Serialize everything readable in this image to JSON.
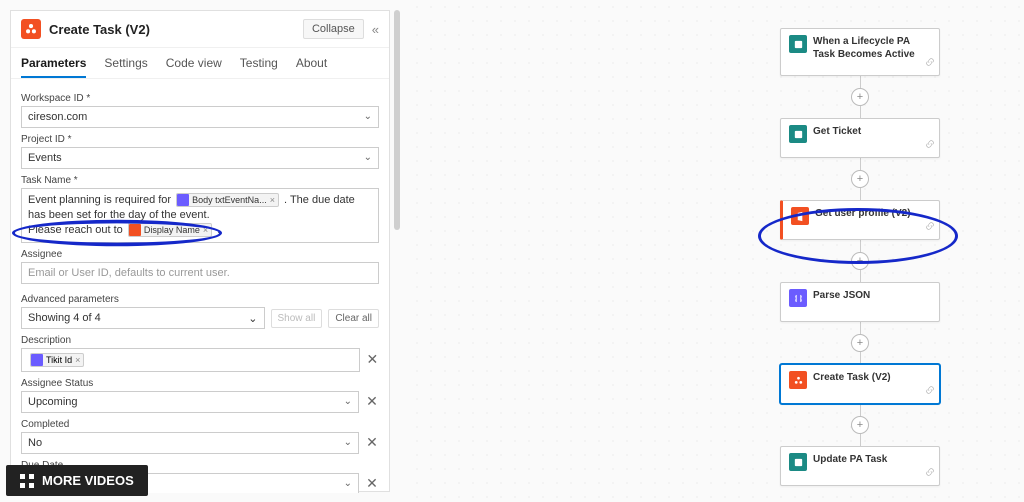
{
  "header": {
    "title": "Create Task (V2)",
    "collapse_label": "Collapse"
  },
  "tabs": [
    {
      "label": "Parameters",
      "active": true
    },
    {
      "label": "Settings",
      "active": false
    },
    {
      "label": "Code view",
      "active": false
    },
    {
      "label": "Testing",
      "active": false
    },
    {
      "label": "About",
      "active": false
    }
  ],
  "form": {
    "workspace_label": "Workspace ID *",
    "workspace_value": "cireson.com",
    "project_label": "Project ID *",
    "project_value": "Events",
    "taskname_label": "Task Name *",
    "taskname_text_pre": "Event planning is required for ",
    "taskname_token1": "Body txtEventNa...",
    "taskname_text_mid": " . The due date has been set for the day of the event.",
    "taskname_text_line2_pre": "Please reach out to ",
    "taskname_token2": "Display Name",
    "taskname_text_line2_post": " .",
    "assignee_label": "Assignee",
    "assignee_placeholder": "Email or User ID, defaults to current user.",
    "advanced_label": "Advanced parameters",
    "advanced_value": "Showing 4 of 4",
    "show_all": "Show all",
    "clear_all": "Clear all",
    "description_label": "Description",
    "description_token": "Tikit Id",
    "assignee_status_label": "Assignee Status",
    "assignee_status_value": "Upcoming",
    "completed_label": "Completed",
    "completed_value": "No",
    "due_date_label": "Due Date"
  },
  "flow": {
    "nodes": [
      {
        "id": "lifecycle",
        "label": "When a Lifecycle PA Task Becomes Active",
        "icon": "teal",
        "accent": false
      },
      {
        "id": "get-ticket",
        "label": "Get Ticket",
        "icon": "teal",
        "accent": false
      },
      {
        "id": "get-user",
        "label": "Get user profile (V2)",
        "icon": "orange",
        "accent": true
      },
      {
        "id": "parse-json",
        "label": "Parse JSON",
        "icon": "purple",
        "accent": false
      },
      {
        "id": "create-task",
        "label": "Create Task (V2)",
        "icon": "orange",
        "accent": false,
        "selected": true
      },
      {
        "id": "update-pa",
        "label": "Update PA Task",
        "icon": "teal",
        "accent": false
      }
    ]
  },
  "overlay": {
    "more_videos": "MORE VIDEOS"
  }
}
